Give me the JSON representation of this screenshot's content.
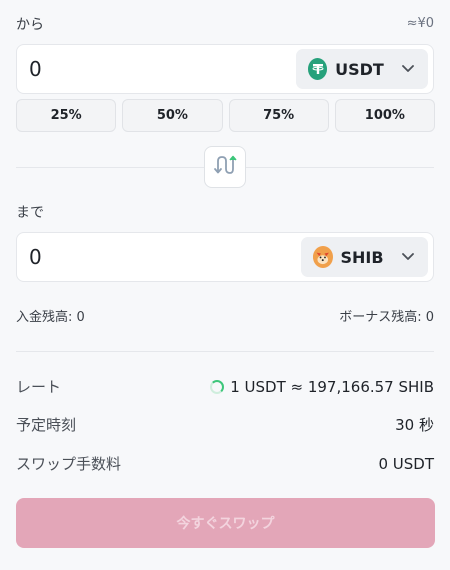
{
  "from": {
    "label": "から",
    "approx_value": "≈¥0",
    "amount": "0",
    "token": "USDT",
    "token_icon": "usdt-icon"
  },
  "percent_buttons": [
    "25%",
    "50%",
    "75%",
    "100%"
  ],
  "swap_icon": "swap-arrows-icon",
  "to": {
    "label": "まで",
    "amount": "0",
    "token": "SHIB",
    "token_icon": "shib-icon"
  },
  "balances": {
    "deposit": "入金残高: 0",
    "bonus": "ボーナス残高: 0"
  },
  "info": {
    "rate_label": "レート",
    "rate_value": "1 USDT ≈ 197,166.57 SHIB",
    "eta_label": "予定時刻",
    "eta_value": "30 秒",
    "fee_label": "スワップ手数料",
    "fee_value": "0 USDT"
  },
  "swap_now_label": "今すぐスワップ",
  "colors": {
    "usdt": "#26a17b",
    "accent_green": "#3dc67a",
    "swap_button_disabled": "#e3a6b8"
  }
}
